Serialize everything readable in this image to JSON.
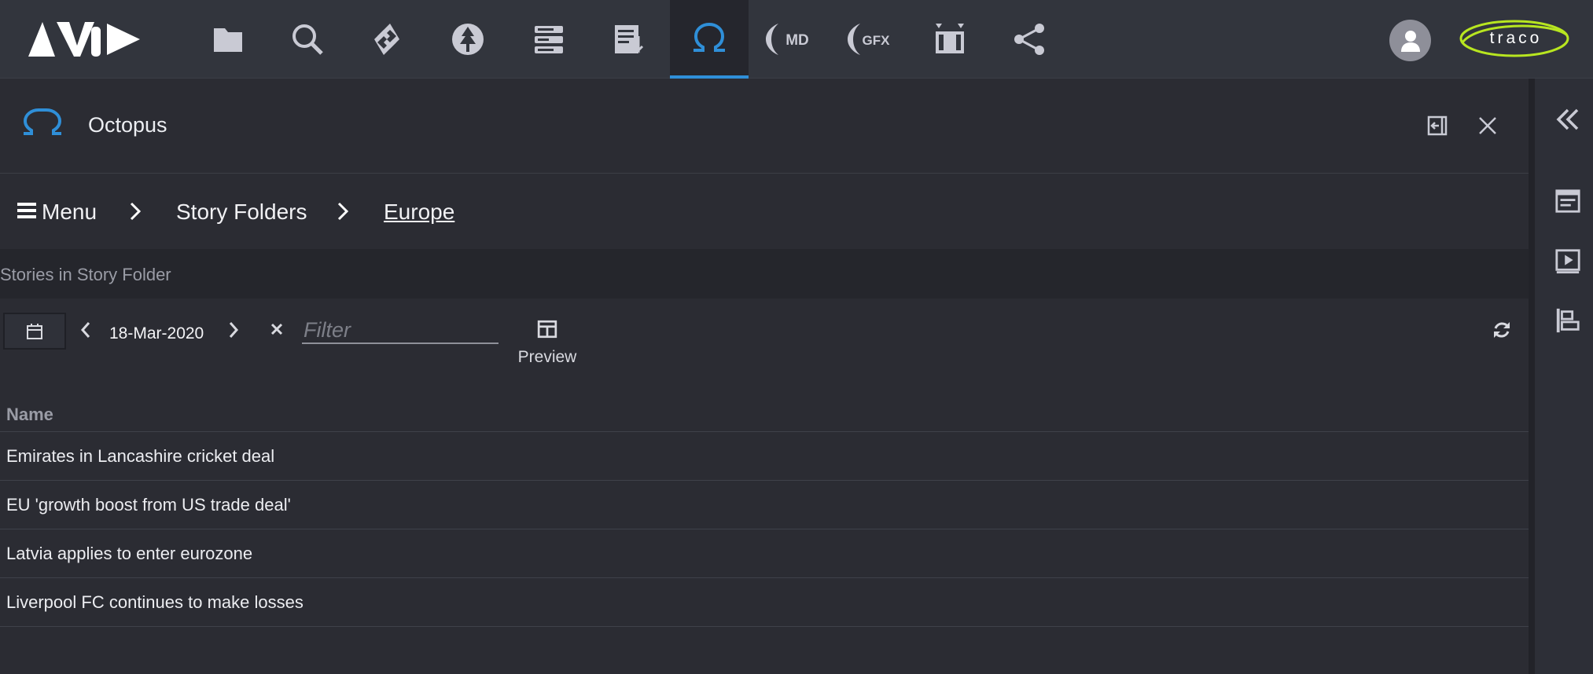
{
  "app": {
    "title": "Octopus"
  },
  "topbar": {
    "icons": [
      {
        "name": "folder-icon"
      },
      {
        "name": "search-icon"
      },
      {
        "name": "connect-icon"
      },
      {
        "name": "tree-icon"
      },
      {
        "name": "storage-icon"
      },
      {
        "name": "rundown-icon"
      },
      {
        "name": "octopus-icon",
        "active": true
      },
      {
        "name": "md-icon",
        "label": "MD"
      },
      {
        "name": "gfx-icon",
        "label": "GFX"
      },
      {
        "name": "studio-icon"
      },
      {
        "name": "share-icon"
      }
    ],
    "brand": "traco",
    "accent": "#2f8fd8"
  },
  "breadcrumb": {
    "menu_label": "Menu",
    "items": [
      "Story Folders",
      "Europe"
    ]
  },
  "section": {
    "label": "Stories in Story Folder"
  },
  "toolbar": {
    "date": "18-Mar-2020",
    "filter_placeholder": "Filter",
    "preview_label": "Preview"
  },
  "table": {
    "header": "Name",
    "rows": [
      "Emirates in Lancashire cricket deal",
      "EU 'growth boost from US trade deal'",
      "Latvia applies to enter eurozone",
      "Liverpool FC continues to make losses"
    ]
  }
}
